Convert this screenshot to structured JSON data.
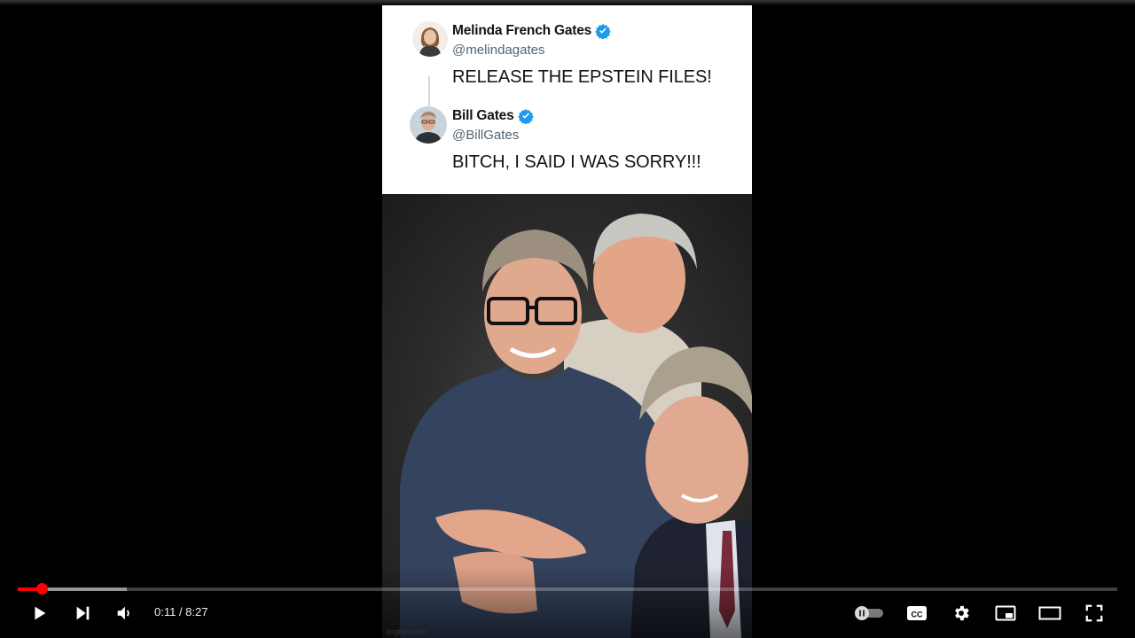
{
  "video": {
    "tweets": [
      {
        "name": "Melinda French Gates",
        "handle": "@melindagates",
        "text": "RELEASE THE EPSTEIN FILES!",
        "verified": true
      },
      {
        "name": "Bill Gates",
        "handle": "@BillGates",
        "text": "BITCH, I SAID I WAS SORRY!!!",
        "verified": true
      }
    ],
    "watermark": "imgflip.com"
  },
  "player": {
    "current_time": "0:11",
    "duration": "8:27",
    "time_display": "0:11 / 8:27",
    "progress_fraction": 0.022,
    "buffered_fraction": 0.099,
    "icons": {
      "play": "play-icon",
      "next": "next-icon",
      "volume": "volume-icon",
      "autoplay": "autoplay-toggle-icon",
      "captions": "captions-icon",
      "settings": "settings-gear-icon",
      "miniplayer": "miniplayer-icon",
      "theater": "theater-mode-icon",
      "fullscreen": "fullscreen-icon"
    },
    "colors": {
      "progress": "#ff0000",
      "verified": "#1d9bf0"
    }
  }
}
